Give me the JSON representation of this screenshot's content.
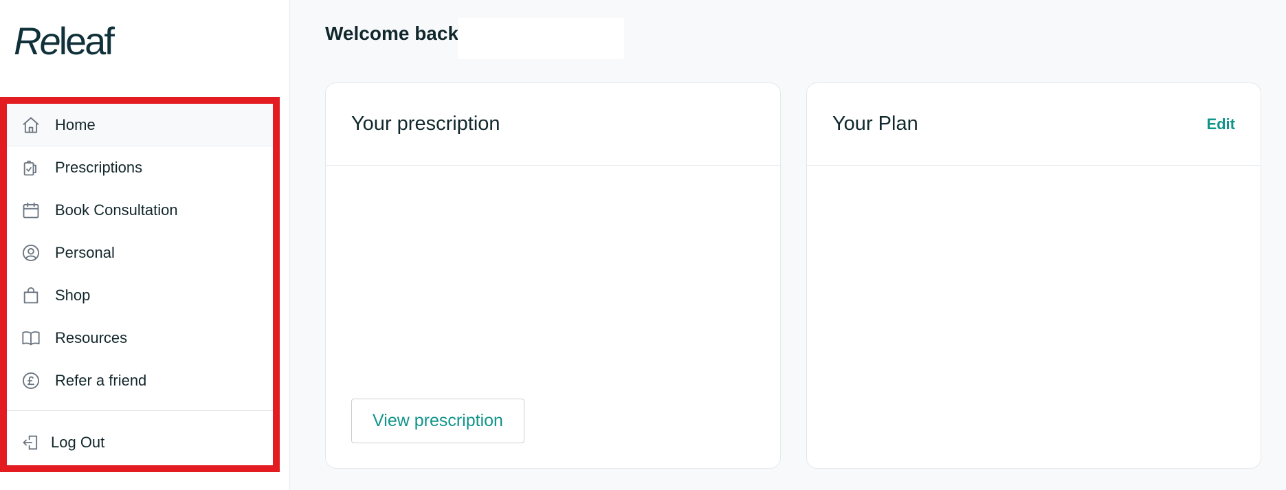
{
  "brand": {
    "logo_part1": "Re",
    "logo_part2": "leaf"
  },
  "sidebar": {
    "items": [
      {
        "label": "Home",
        "icon": "home-icon"
      },
      {
        "label": "Prescriptions",
        "icon": "clipboard-check-icon"
      },
      {
        "label": "Book Consultation",
        "icon": "calendar-icon"
      },
      {
        "label": "Personal",
        "icon": "user-circle-icon"
      },
      {
        "label": "Shop",
        "icon": "shopping-bag-icon"
      },
      {
        "label": "Resources",
        "icon": "book-open-icon"
      },
      {
        "label": "Refer a friend",
        "icon": "pound-circle-icon"
      }
    ],
    "logout": {
      "label": "Log Out",
      "icon": "logout-icon"
    }
  },
  "main": {
    "welcome": "Welcome back",
    "prescription_card": {
      "title": "Your prescription",
      "button": "View prescription"
    },
    "plan_card": {
      "title": "Your Plan",
      "edit": "Edit"
    }
  },
  "colors": {
    "accent": "#10948a",
    "highlight_border": "#e31c22",
    "text": "#10282d"
  }
}
